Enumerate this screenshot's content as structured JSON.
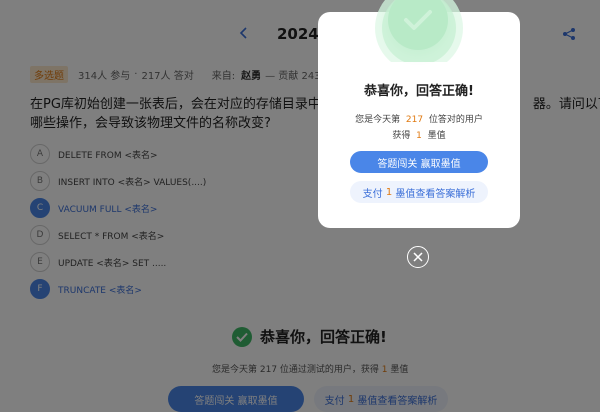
{
  "header": {
    "date_title": "2024-11-",
    "prev_icon": "chevron-left-icon",
    "share_icon": "share-icon"
  },
  "meta": {
    "tag": "多选题",
    "participants": "314人 参与",
    "dot": "·",
    "answered": "217人 答对",
    "source_label": "来自:",
    "author": "赵勇",
    "contribution": "— 贡献 243 题"
  },
  "question": {
    "line1": "在PG库初始创建一张表后，会在对应的存储目录中，有一个",
    "line1_tail": "器。请问以下",
    "line2": "哪些操作，会导致该物理文件的名称改变?"
  },
  "options": [
    {
      "letter": "A",
      "text": "DELETE FROM <表名>",
      "selected": false
    },
    {
      "letter": "B",
      "text": "INSERT INTO <表名> VALUES(....)",
      "selected": false
    },
    {
      "letter": "C",
      "text": "VACUUM FULL <表名>",
      "selected": true
    },
    {
      "letter": "D",
      "text": "SELECT * FROM <表名>",
      "selected": false
    },
    {
      "letter": "E",
      "text": "UPDATE <表名> SET .....",
      "selected": false
    },
    {
      "letter": "F",
      "text": "TRUNCATE <表名>",
      "selected": true
    }
  ],
  "result": {
    "title": "恭喜你，回答正确!",
    "sub_prefix": "您是今天第 217 位通过测试的用户，获得",
    "sub_value": "1",
    "sub_suffix": "墨值",
    "primary": "答题闯关 赢取墨值",
    "secondary_prefix": "支付",
    "secondary_value": "1",
    "secondary_suffix": "墨值查看答案解析"
  },
  "modal": {
    "title": "恭喜你，回答正确!",
    "line1_prefix": "您是今天第",
    "line1_value": "217",
    "line1_suffix": "位答对的用户",
    "line2_prefix": "获得",
    "line2_value": "1",
    "line2_suffix": "墨值",
    "primary": "答题闯关 赢取墨值",
    "secondary_prefix": "支付",
    "secondary_value": "1",
    "secondary_suffix": "墨值查看答案解析",
    "check_icon": "check-circle-icon",
    "close_icon": "close-circle-icon"
  },
  "colors": {
    "accent_blue": "#4a86e8",
    "success_green": "#41b868",
    "highlight_orange": "#e07a12",
    "overlay": "rgba(0,0,0,0.5)"
  }
}
